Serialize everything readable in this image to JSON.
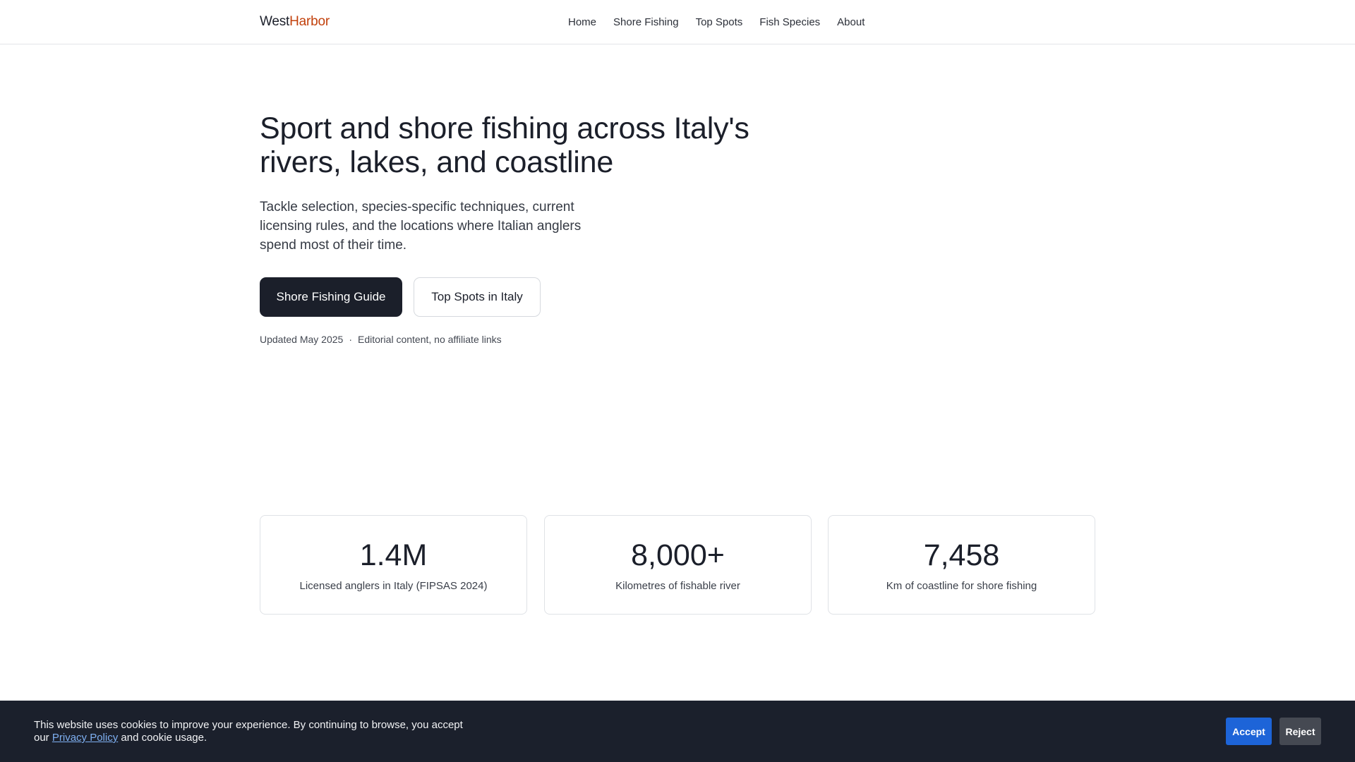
{
  "header": {
    "logo_main": "West",
    "logo_accent": "Harbor",
    "nav": [
      "Home",
      "Shore Fishing",
      "Top Spots",
      "Fish Species",
      "About"
    ]
  },
  "hero": {
    "title": "Sport and shore fishing across Italy's rivers, lakes, and coastline",
    "subtitle": "Tackle selection, species-specific techniques, current licensing rules, and the locations where Italian anglers spend most of their time.",
    "primary_button": "Shore Fishing Guide",
    "secondary_button": "Top Spots in Italy",
    "updated": "Updated May 2025",
    "separator": "·",
    "editorial_note": "Editorial content, no affiliate links"
  },
  "stats": [
    {
      "value": "1.4M",
      "label": "Licensed anglers in Italy (FIPSAS 2024)"
    },
    {
      "value": "8,000+",
      "label": "Kilometres of fishable river"
    },
    {
      "value": "7,458",
      "label": "Km of coastline for shore fishing"
    }
  ],
  "cookie": {
    "text_before": "This website uses cookies to improve your experience. By continuing to browse, you accept our ",
    "link": "Privacy Policy",
    "text_after": " and cookie usage.",
    "accept": "Accept",
    "reject": "Reject"
  },
  "colors": {
    "brand_accent": "#c2410c",
    "primary_button_bg": "#1b1f2a",
    "banner_bg": "#1b202c",
    "accept_bg": "#1d64d8",
    "reject_bg": "#454952",
    "link": "#7fb0f2"
  }
}
